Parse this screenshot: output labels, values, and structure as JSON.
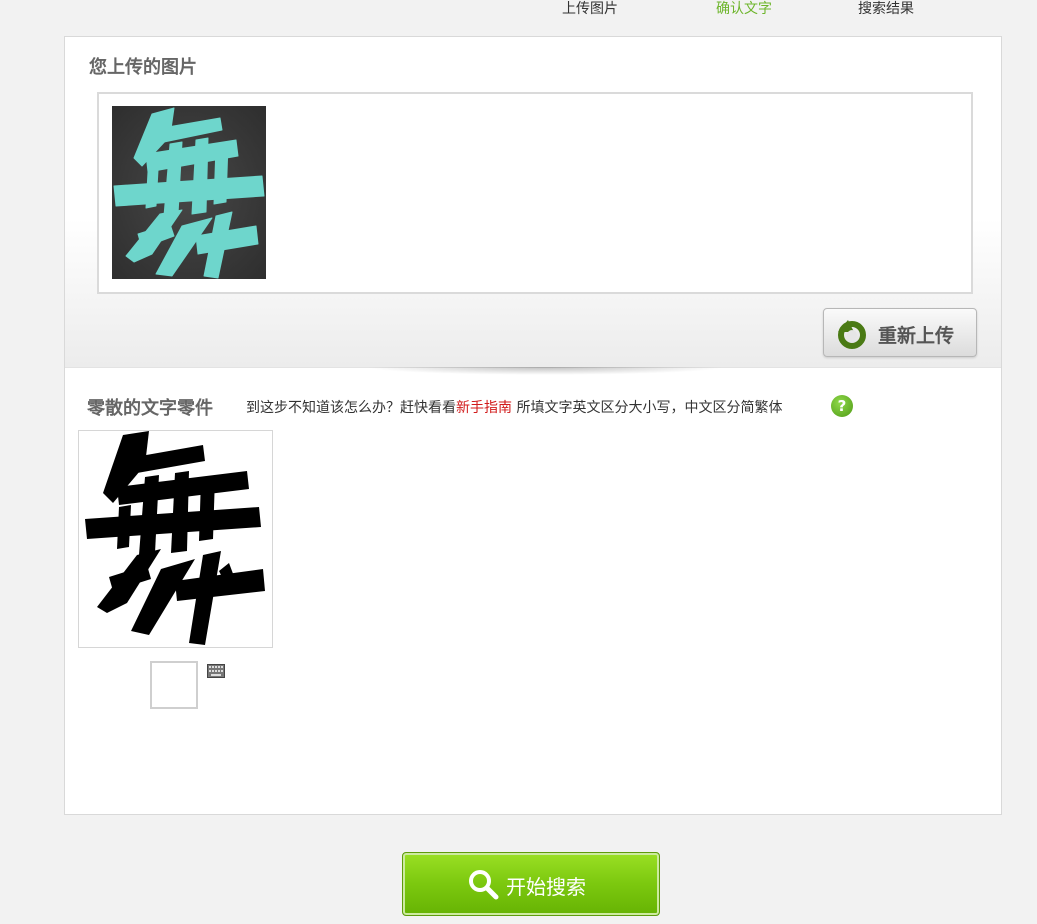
{
  "steps": [
    {
      "label": "上传图片",
      "active": false
    },
    {
      "label": "确认文字",
      "active": true
    },
    {
      "label": "搜索结果",
      "active": false
    }
  ],
  "upload": {
    "title": "您上传的图片",
    "reupload_label": "重新上传"
  },
  "parts": {
    "title": "零散的文字零件",
    "hint_prefix": "到这步不知道该怎么办？赶快看看",
    "hint_link": "新手指南",
    "hint_suffix": " 所填文字英文区分大小写，中文区分简繁体",
    "help_symbol": "?",
    "char_input_value": ""
  },
  "search": {
    "label": "开始搜索"
  },
  "colors": {
    "active_step": "#6db52b",
    "link": "#d11a1a",
    "search_button": "#7cc80f",
    "thumb_glyph": "#6ed6cc"
  },
  "icons": [
    "reupload-arrow-icon",
    "help-icon",
    "keyboard-icon",
    "search-icon"
  ]
}
